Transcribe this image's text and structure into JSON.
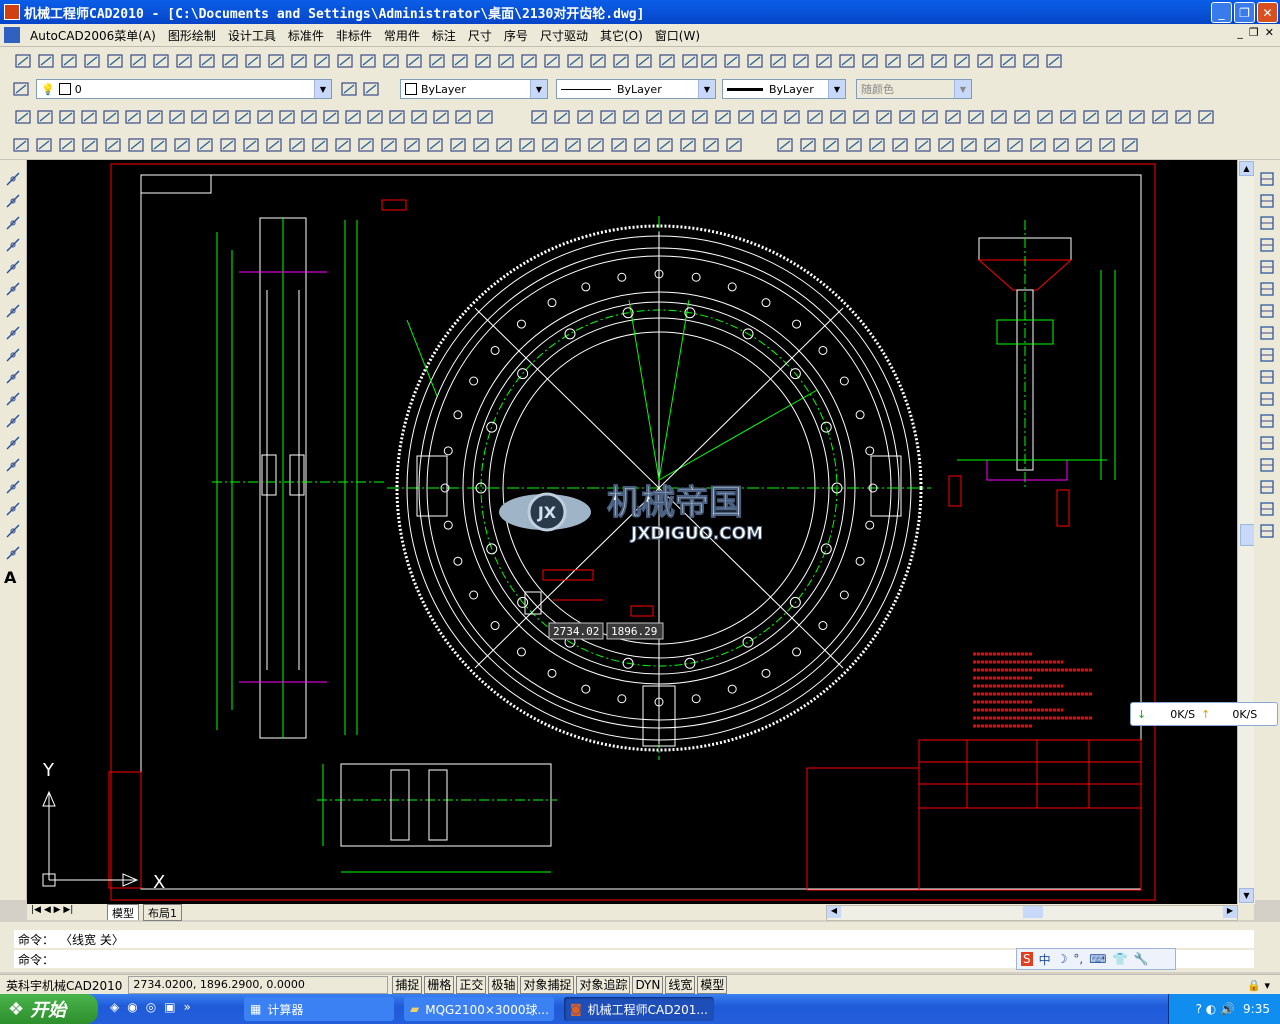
{
  "window": {
    "title": "机械工程师CAD2010 - [C:\\Documents and Settings\\Administrator\\桌面\\2130对开齿轮.dwg]"
  },
  "menu": {
    "items": [
      "AutoCAD2006菜单(A)",
      "图形绘制",
      "设计工具",
      "标准件",
      "非标件",
      "常用件",
      "标注",
      "尺寸",
      "序号",
      "尺寸驱动",
      "其它(O)",
      "窗口(W)"
    ]
  },
  "layers": {
    "current_layer": "0",
    "color": "ByLayer",
    "linetype": "ByLayer",
    "lineweight": "ByLayer",
    "plotstyle": "随颜色"
  },
  "canvas": {
    "watermark_cn": "机械帝国",
    "watermark_en": "JXDIGUO.COM",
    "coord_x_tooltip": "2734.02",
    "coord_y_tooltip": "1896.29",
    "ucs_y": "Y",
    "ucs_x": "X"
  },
  "tabs": {
    "model": "模型",
    "layout1": "布局1"
  },
  "command": {
    "line1_label": "命令：",
    "line1_text": "〈线宽 关〉",
    "line2_label": "命令："
  },
  "status": {
    "app": "英科宇机械CAD2010",
    "coords": "2734.0200, 1896.2900, 0.0000",
    "buttons": [
      "捕捉",
      "栅格",
      "正交",
      "极轴",
      "对象捕捉",
      "对象追踪",
      "DYN",
      "线宽",
      "模型"
    ]
  },
  "netspeed": {
    "down": "0K/S",
    "up": "0K/S"
  },
  "ime": {
    "label": "中"
  },
  "taskbar": {
    "start": "开始",
    "tasks": [
      "计算器",
      "MQG2100×3000球...",
      "机械工程师CAD201..."
    ],
    "clock": "9:35"
  },
  "colors": {
    "titlebar": "#0a5ee8",
    "canvas_bg": "#000000",
    "cad_green": "#00ff00",
    "cad_white": "#ffffff",
    "cad_red": "#ff0000",
    "cad_magenta": "#ff00ff",
    "cad_yellow": "#ffff00"
  }
}
